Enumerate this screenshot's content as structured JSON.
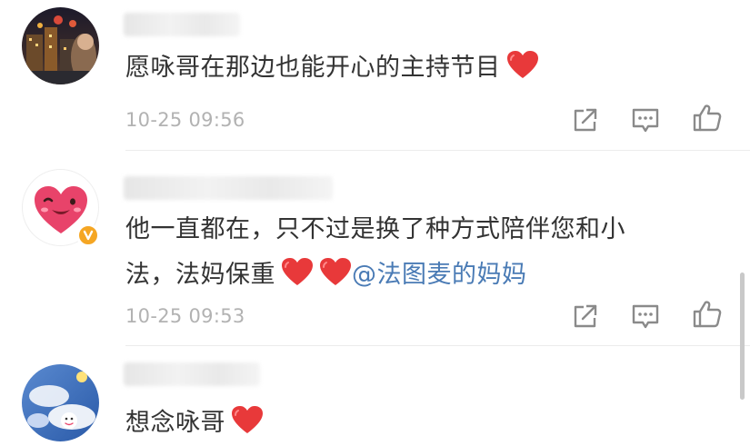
{
  "comments": [
    {
      "username": "",
      "text": "愿咏哥在那边也能开心的主持节目",
      "hearts": 1,
      "timestamp": "10-25 09:56",
      "avatar": "night-city-photo",
      "verified": false
    },
    {
      "username": "",
      "text_line1": "他一直都在，只不过是换了种方式陪伴您和小",
      "text_line2": "法，法妈保重",
      "hearts": 2,
      "mention": "@法图麦的妈妈",
      "timestamp": "10-25 09:53",
      "avatar": "winking-heart-emoji",
      "verified": true
    },
    {
      "username": "",
      "text": "想念咏哥",
      "hearts": 1,
      "avatar": "cloud-sky-photo",
      "verified": false
    }
  ],
  "actions": {
    "share_icon": "share-icon",
    "reply_icon": "comment-icon",
    "like_icon": "thumbs-up-icon"
  },
  "colors": {
    "heart": "#e8393a",
    "mention": "#4a7bb5",
    "timestamp": "#b2b2b2",
    "text": "#333333",
    "verified_badge": "#f5a623"
  }
}
